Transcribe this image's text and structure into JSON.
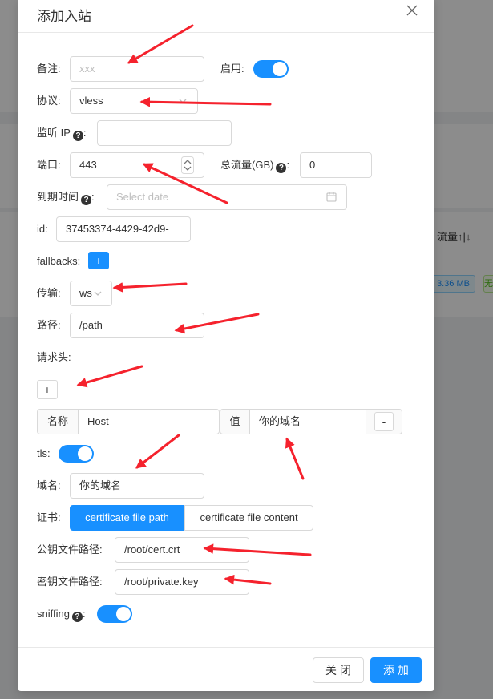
{
  "background": {
    "header_cell": "流量↑|↓",
    "size_tag": "3.36 MB",
    "green_tag": "无"
  },
  "modal": {
    "title": "添加入站",
    "cancel_label": "关 闭",
    "ok_label": "添 加"
  },
  "form": {
    "remark": {
      "label": "备注:",
      "placeholder": "xxx"
    },
    "enable": {
      "label": "启用:",
      "on": true
    },
    "protocol": {
      "label": "协议:",
      "value": "vless"
    },
    "listen_ip": {
      "label": "监听 IP",
      "suffix": ":",
      "value": ""
    },
    "port": {
      "label": "端口:",
      "value": "443"
    },
    "total_traffic": {
      "label": "总流量(GB)",
      "suffix": ":",
      "value": "0"
    },
    "expiry": {
      "label": "到期时间",
      "suffix": ":",
      "placeholder": "Select date"
    },
    "id": {
      "label": "id:",
      "value": "37453374-4429-42d9-"
    },
    "fallbacks": {
      "label": "fallbacks:",
      "add": "+"
    },
    "transport": {
      "label": "传输:",
      "value": "ws"
    },
    "path": {
      "label": "路径:",
      "value": "/path"
    },
    "headers": {
      "label": "请求头:",
      "add": "+",
      "name_addon": "名称",
      "name_value": "Host",
      "value_addon": "值",
      "value_value": "你的域名",
      "remove": "-"
    },
    "tls": {
      "label": "tls:",
      "on": true
    },
    "domain": {
      "label": "域名:",
      "value": "你的域名"
    },
    "cert": {
      "label": "证书:",
      "option_path": "certificate file path",
      "option_content": "certificate file content"
    },
    "public_key": {
      "label": "公钥文件路径:",
      "value": "/root/cert.crt"
    },
    "private_key": {
      "label": "密钥文件路径:",
      "value": "/root/private.key"
    },
    "sniffing": {
      "label": "sniffing",
      "suffix": ":",
      "on": true
    },
    "help_glyph": "?"
  },
  "colors": {
    "primary": "#1890ff",
    "annotation_arrow": "#f5222d"
  }
}
